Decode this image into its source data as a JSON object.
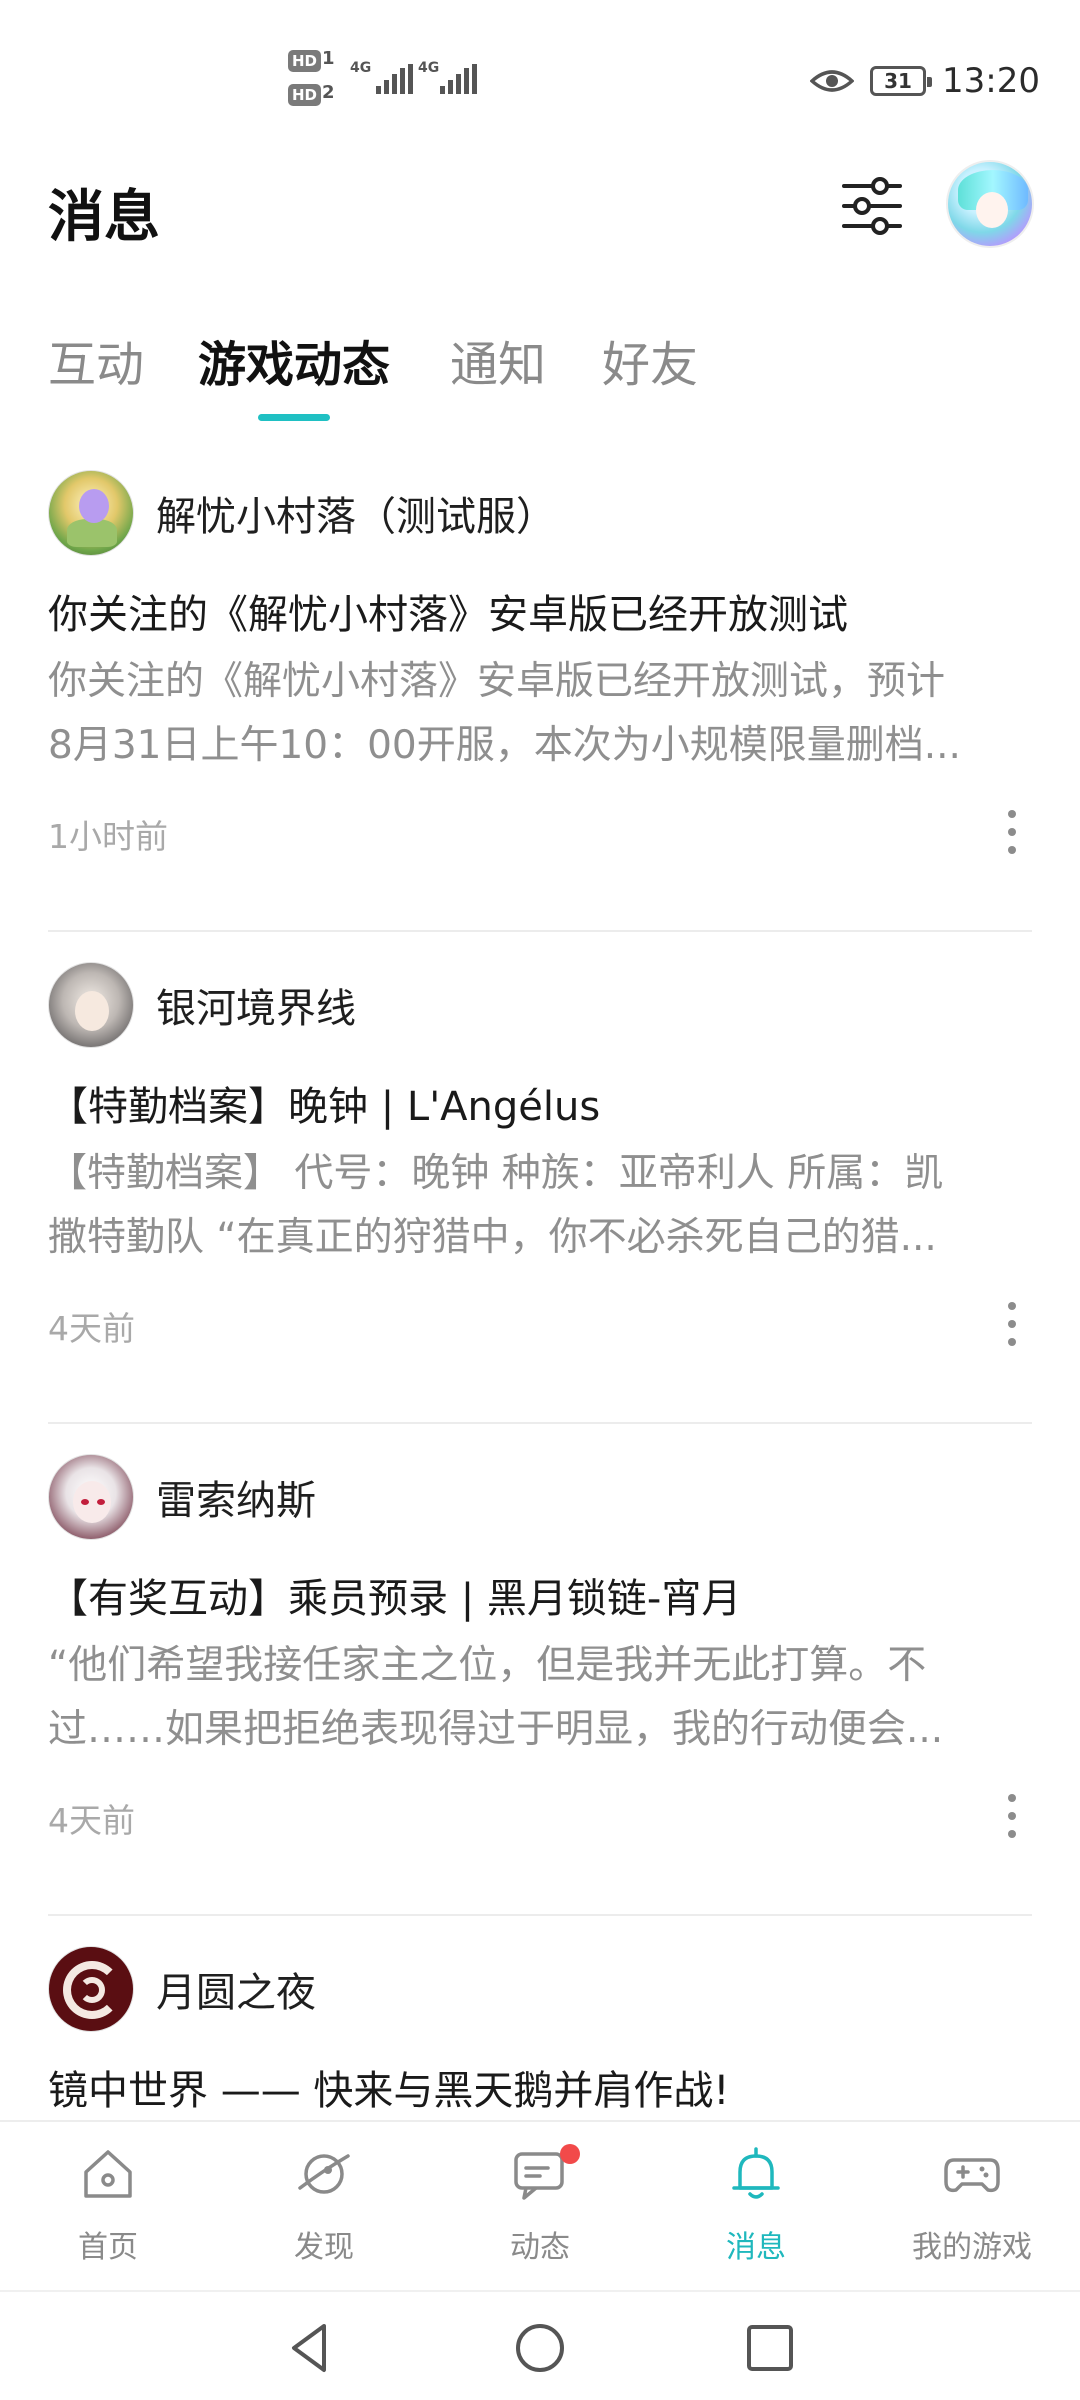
{
  "status_bar": {
    "sim1": "1",
    "sim2": "2",
    "hd_label": "HD",
    "network_type": "4G",
    "battery": "31",
    "time": "13:20"
  },
  "header": {
    "title": "消息"
  },
  "tabs": [
    {
      "label": "互动"
    },
    {
      "label": "游戏动态"
    },
    {
      "label": "通知"
    },
    {
      "label": "好友"
    }
  ],
  "active_tab": "游戏动态",
  "feed": [
    {
      "source": "解忧小村落（测试服）",
      "title": "你关注的《解忧小村落》安卓版已经开放测试",
      "body_line1": "你关注的《解忧小村落》安卓版已经开放测试，预计",
      "body_line2": "8月31日上午10：00开服，本次为小规模限量删档...",
      "time": "1小时前"
    },
    {
      "source": "银河境界线",
      "title": "【特勤档案】晚钟 | L'Angélus",
      "body_line1": "【特勤档案】 代号：晚钟 种族：亚帝利人 所属：凯",
      "body_line2": "撒特勤队 “在真正的狩猎中，你不必杀死自己的猎...",
      "time": "4天前"
    },
    {
      "source": "雷索纳斯",
      "title": "【有奖互动】乘员预录 | 黑月锁链-宵月",
      "body_line1": "“他们希望我接任家主之位，但是我并无此打算。不",
      "body_line2": "过……如果把拒绝表现得过于明显，我的行动便会...",
      "time": "4天前"
    },
    {
      "source": "月圆之夜",
      "title": "镜中世界 —— 快来与黑天鹅并肩作战!",
      "body_line1": "",
      "body_line2": "",
      "time": ""
    }
  ],
  "bottom_nav": [
    {
      "label": "首页",
      "icon": "home-icon"
    },
    {
      "label": "发现",
      "icon": "compass-planet-icon"
    },
    {
      "label": "动态",
      "icon": "chat-bubble-icon"
    },
    {
      "label": "消息",
      "icon": "bell-icon"
    },
    {
      "label": "我的游戏",
      "icon": "gamepad-icon"
    }
  ],
  "colors": {
    "accent": "#1fc0c3",
    "badge": "#f24a4a",
    "secondary_text": "#8f8f8f",
    "time_text": "#a9a9a9"
  }
}
